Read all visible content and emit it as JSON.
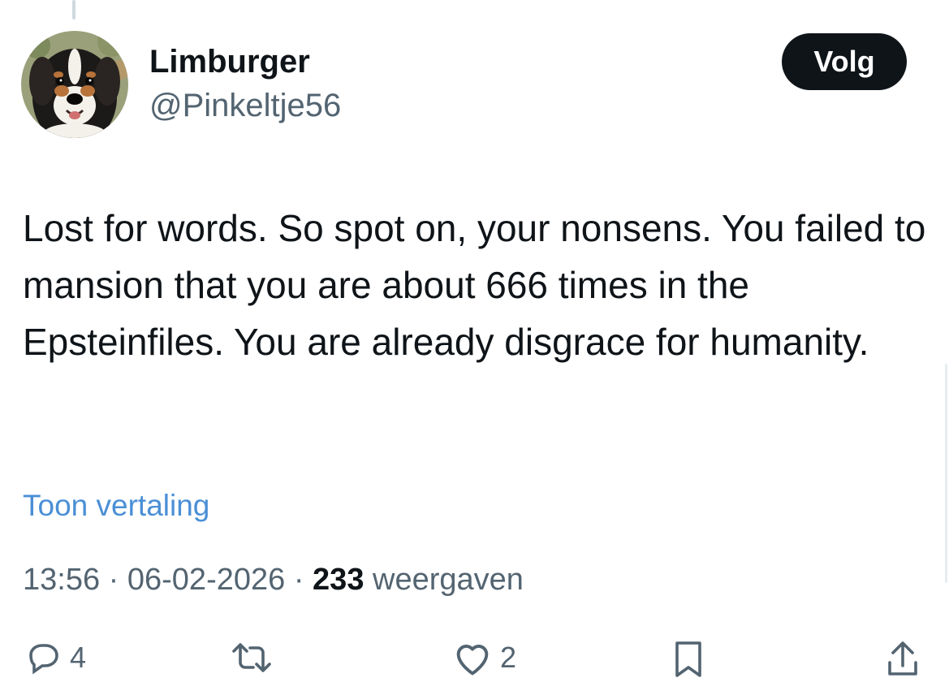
{
  "author": {
    "display_name": "Limburger",
    "handle": "@Pinkeltje56",
    "avatar_icon": "dog-avatar-icon"
  },
  "follow_button": {
    "label": "Volg"
  },
  "tweet": {
    "text": "Lost for words. So spot on, your nonsens. You failed to mansion that you are about 666 times in the Epsteinfiles. You are already disgrace for humanity.",
    "translate_label": "Toon vertaling"
  },
  "meta": {
    "time": "13:56",
    "separator": " · ",
    "date": "06-02-2026",
    "views_count": "233",
    "views_label": "weergaven"
  },
  "actions": {
    "reply": {
      "icon": "reply-icon",
      "count": "4"
    },
    "retweet": {
      "icon": "retweet-icon",
      "count": ""
    },
    "like": {
      "icon": "heart-icon",
      "count": "2"
    },
    "bookmark": {
      "icon": "bookmark-icon"
    },
    "share": {
      "icon": "share-icon"
    }
  },
  "colors": {
    "text_primary": "#0f1419",
    "text_secondary": "#536471",
    "link": "#4a8fd6",
    "button_bg": "#0f1419",
    "button_text": "#ffffff"
  }
}
